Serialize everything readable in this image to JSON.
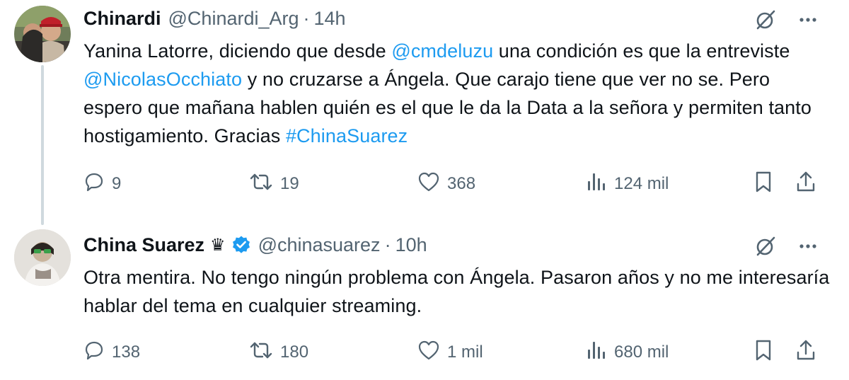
{
  "tweets": [
    {
      "author": {
        "name": "Chinardi",
        "handle": "@Chinardi_Arg",
        "has_crown": false,
        "verified": false
      },
      "separator": "·",
      "time": "14h",
      "text_segments": [
        {
          "text": "Yanina Latorre, diciendo que desde ",
          "link": false
        },
        {
          "text": "@cmdeluzu",
          "link": true
        },
        {
          "text": " una condición es que la entreviste ",
          "link": false
        },
        {
          "text": "@NicolasOcchiato",
          "link": true
        },
        {
          "text": " y no cruzarse a Ángela. Que carajo tiene que ver no se. Pero espero que mañana hablen quién es el que le da la Data a la señora y permiten tanto hostigamiento. Gracias ",
          "link": false
        },
        {
          "text": "#ChinaSuarez",
          "link": true
        }
      ],
      "stats": {
        "replies": "9",
        "retweets": "19",
        "likes": "368",
        "views": "124 mil"
      }
    },
    {
      "author": {
        "name": "China Suarez",
        "handle": "@chinasuarez",
        "has_crown": true,
        "verified": true
      },
      "separator": "·",
      "time": "10h",
      "text_segments": [
        {
          "text": "Otra mentira. No tengo ningún problema con Ángela. Pasaron años y no me interesaría hablar del tema en cualquier streaming.",
          "link": false
        }
      ],
      "stats": {
        "replies": "138",
        "retweets": "180",
        "likes": "1 mil",
        "views": "680 mil"
      }
    }
  ],
  "icons": {
    "grok": "grok-icon",
    "more": "more-icon",
    "reply": "reply-icon",
    "retweet": "retweet-icon",
    "like": "heart-icon",
    "views": "views-icon",
    "bookmark": "bookmark-icon",
    "share": "share-icon",
    "crown": "♛"
  },
  "colors": {
    "text": "#0f1419",
    "secondary": "#536471",
    "link": "#1d9bf0",
    "verified": "#1d9bf0",
    "thread_line": "#cfd9de"
  }
}
